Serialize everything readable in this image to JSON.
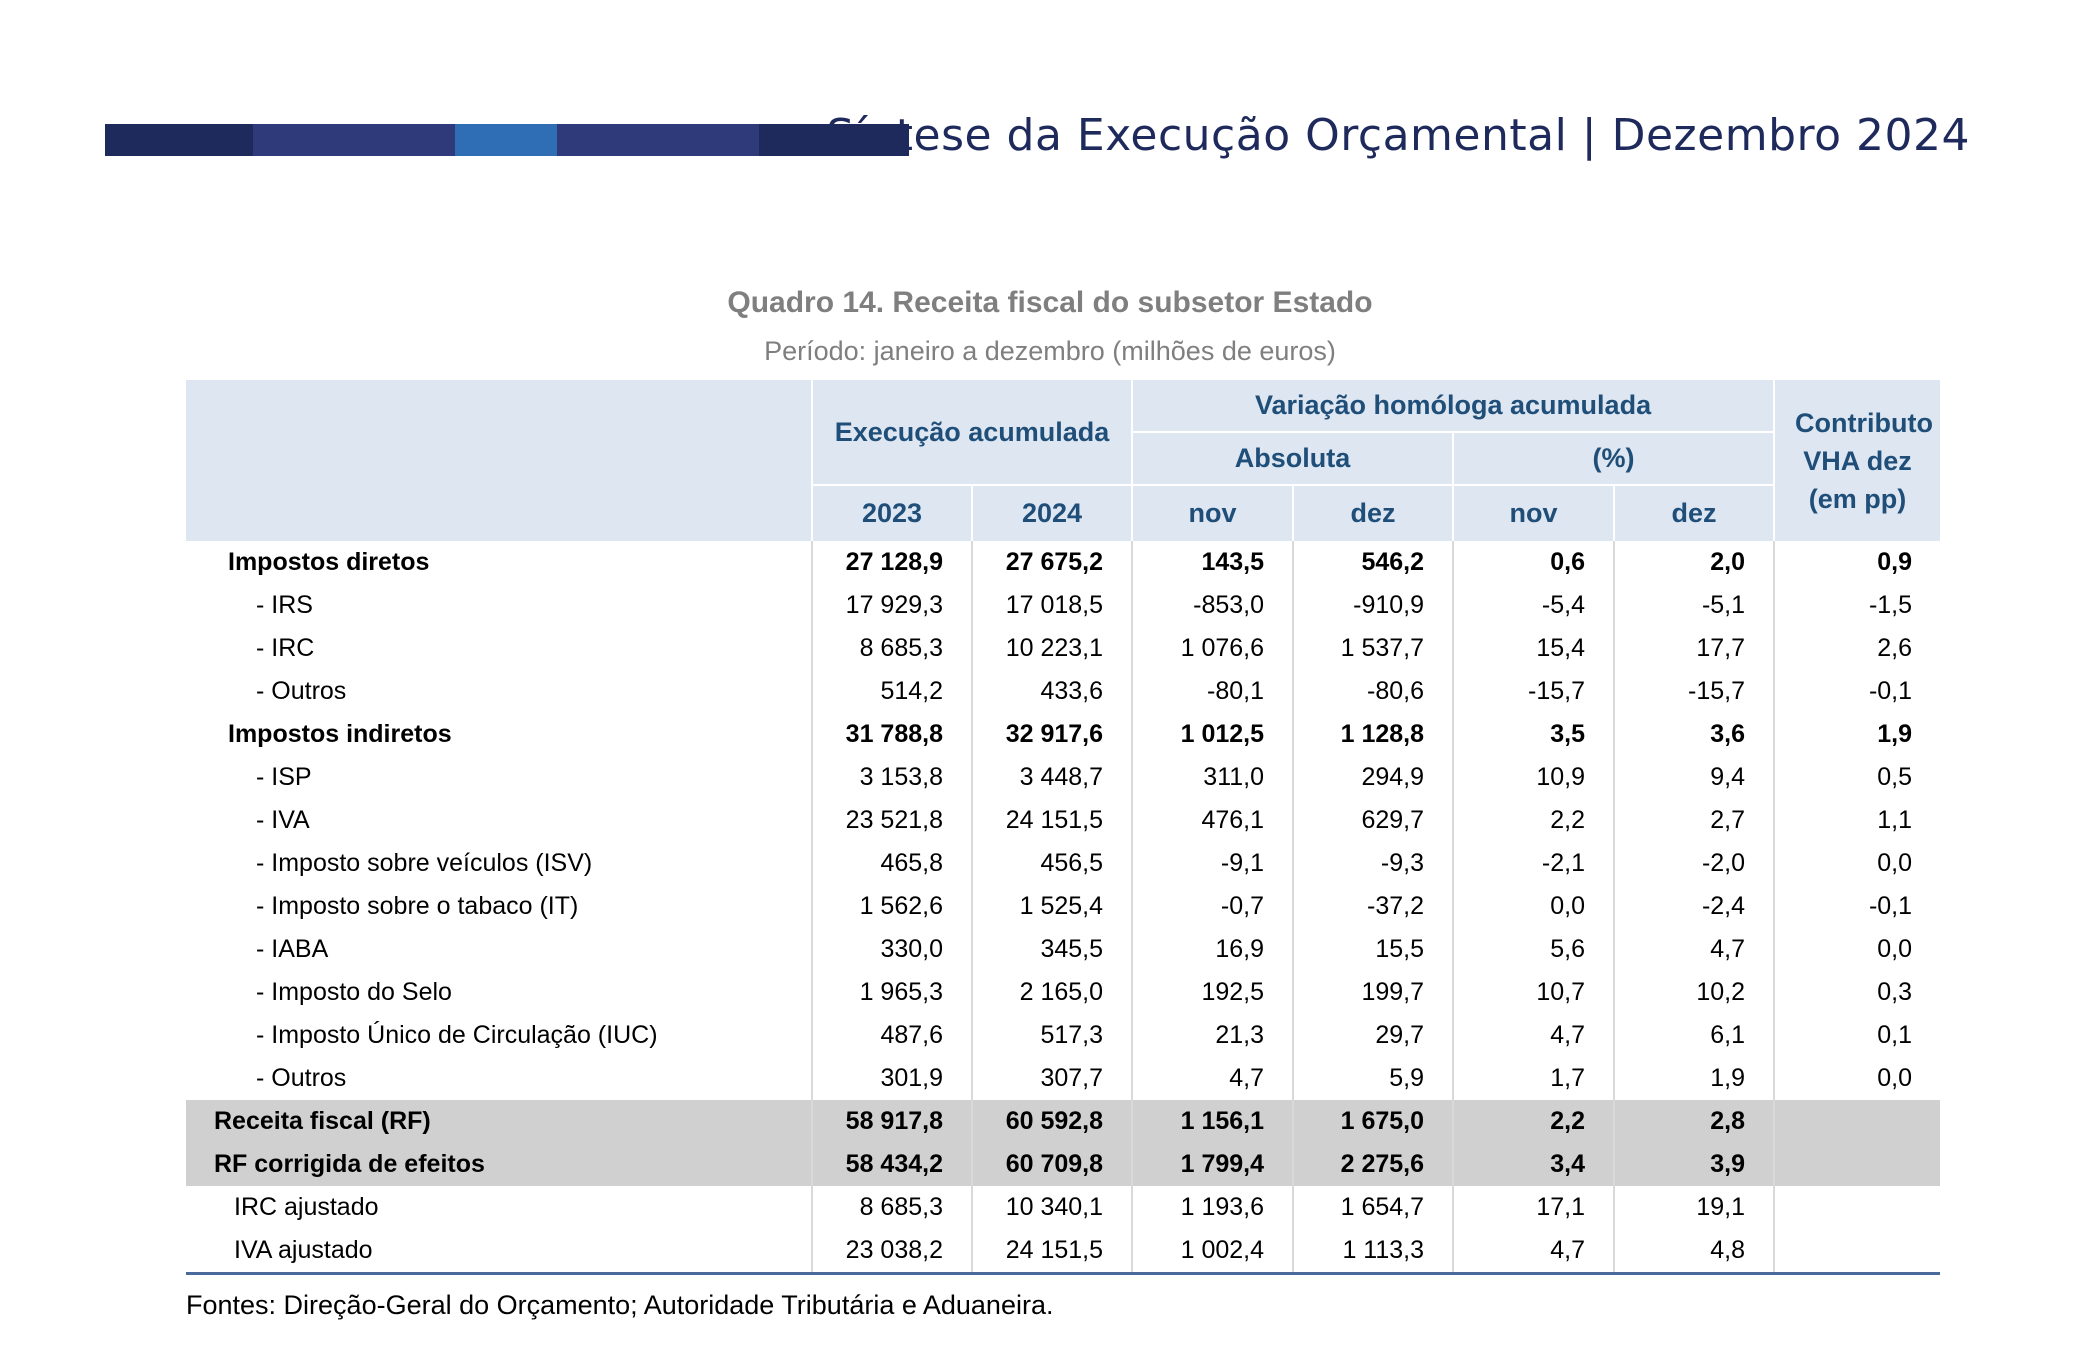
{
  "header": {
    "title": "Síntese da Execução Orçamental | Dezembro 2024",
    "band_colors": [
      "#1f2a5c",
      "#2e3a7a",
      "#2f6db5",
      "#2e3a7a",
      "#1f2a5c"
    ]
  },
  "table": {
    "title": "Quadro 14. Receita fiscal do subsetor Estado",
    "subtitle": "Período: janeiro a dezembro (milhões de euros)",
    "headers": {
      "execucao": "Execução acumulada",
      "variacao": "Variação homóloga acumulada",
      "absoluta": "Absoluta",
      "percent": "(%)",
      "contributo": "Contributo VHA dez (em pp)",
      "y2023": "2023",
      "y2024": "2024",
      "abs_nov": "nov",
      "abs_dez": "dez",
      "pct_nov": "nov",
      "pct_dez": "dez"
    },
    "rows": [
      {
        "label": "Impostos diretos",
        "v": [
          "27 128,9",
          "27 675,2",
          "143,5",
          "546,2",
          "0,6",
          "2,0",
          "0,9"
        ]
      },
      {
        "label": "- IRS",
        "v": [
          "17 929,3",
          "17 018,5",
          "-853,0",
          "-910,9",
          "-5,4",
          "-5,1",
          "-1,5"
        ]
      },
      {
        "label": "- IRC",
        "v": [
          "8 685,3",
          "10 223,1",
          "1 076,6",
          "1 537,7",
          "15,4",
          "17,7",
          "2,6"
        ]
      },
      {
        "label": "- Outros",
        "v": [
          "514,2",
          "433,6",
          "-80,1",
          "-80,6",
          "-15,7",
          "-15,7",
          "-0,1"
        ]
      },
      {
        "label": "Impostos indiretos",
        "v": [
          "31 788,8",
          "32 917,6",
          "1 012,5",
          "1 128,8",
          "3,5",
          "3,6",
          "1,9"
        ]
      },
      {
        "label": "- ISP",
        "v": [
          "3 153,8",
          "3 448,7",
          "311,0",
          "294,9",
          "10,9",
          "9,4",
          "0,5"
        ]
      },
      {
        "label": "- IVA",
        "v": [
          "23 521,8",
          "24 151,5",
          "476,1",
          "629,7",
          "2,2",
          "2,7",
          "1,1"
        ]
      },
      {
        "label": "- Imposto sobre veículos (ISV)",
        "v": [
          "465,8",
          "456,5",
          "-9,1",
          "-9,3",
          "-2,1",
          "-2,0",
          "0,0"
        ]
      },
      {
        "label": "- Imposto sobre o tabaco (IT)",
        "v": [
          "1 562,6",
          "1 525,4",
          "-0,7",
          "-37,2",
          "0,0",
          "-2,4",
          "-0,1"
        ]
      },
      {
        "label": "- IABA",
        "v": [
          "330,0",
          "345,5",
          "16,9",
          "15,5",
          "5,6",
          "4,7",
          "0,0"
        ]
      },
      {
        "label": "- Imposto do Selo",
        "v": [
          "1 965,3",
          "2 165,0",
          "192,5",
          "199,7",
          "10,7",
          "10,2",
          "0,3"
        ]
      },
      {
        "label": "- Imposto Único de Circulação (IUC)",
        "v": [
          "487,6",
          "517,3",
          "21,3",
          "29,7",
          "4,7",
          "6,1",
          "0,1"
        ]
      },
      {
        "label": "- Outros",
        "v": [
          "301,9",
          "307,7",
          "4,7",
          "5,9",
          "1,7",
          "1,9",
          "0,0"
        ]
      },
      {
        "label": "Receita fiscal (RF)",
        "v": [
          "58 917,8",
          "60 592,8",
          "1 156,1",
          "1 675,0",
          "2,2",
          "2,8",
          ""
        ]
      },
      {
        "label": "RF corrigida de efeitos",
        "v": [
          "58 434,2",
          "60 709,8",
          "1 799,4",
          "2 275,6",
          "3,4",
          "3,9",
          ""
        ]
      },
      {
        "label": "IRC ajustado",
        "v": [
          "8 685,3",
          "10 340,1",
          "1 193,6",
          "1 654,7",
          "17,1",
          "19,1",
          ""
        ]
      },
      {
        "label": "IVA ajustado",
        "v": [
          "23 038,2",
          "24 151,5",
          "1 002,4",
          "1 113,3",
          "4,7",
          "4,8",
          ""
        ]
      }
    ]
  },
  "footnote": "Fontes: Direção-Geral do Orçamento; Autoridade Tributária e Aduaneira."
}
